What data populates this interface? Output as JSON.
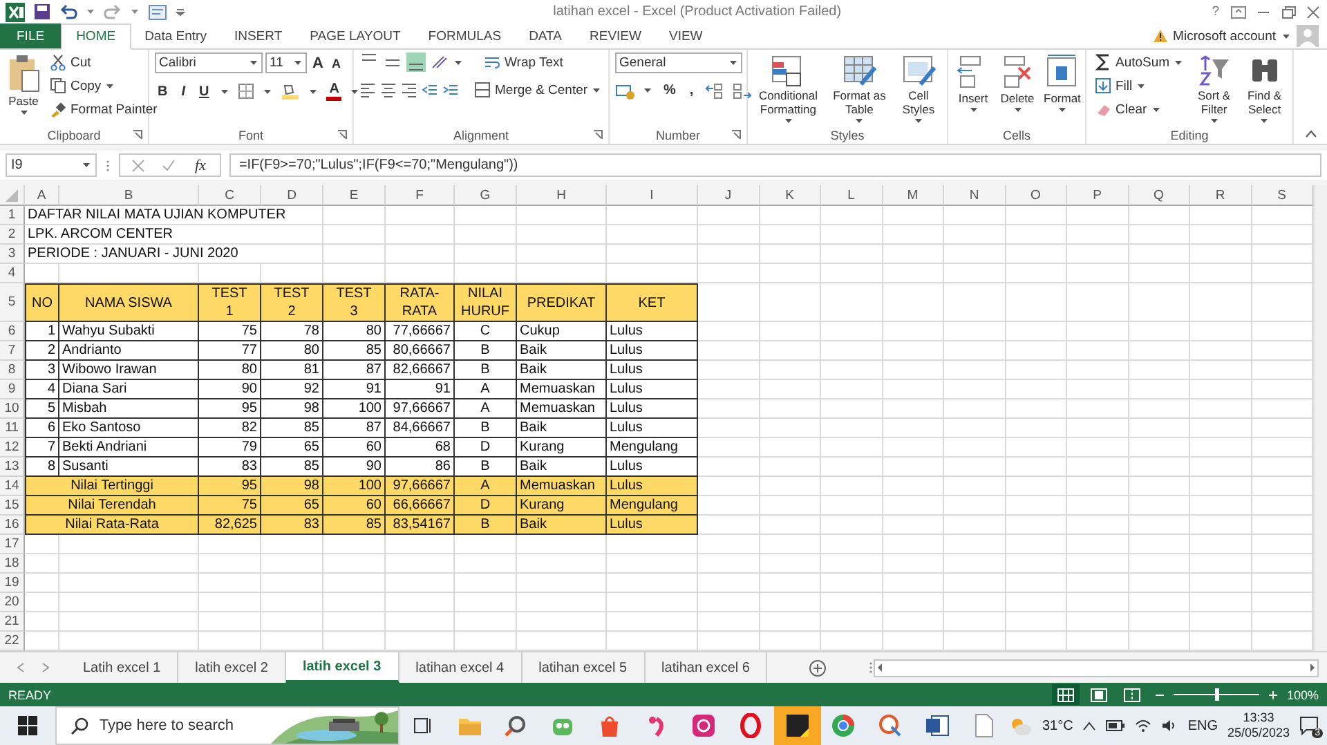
{
  "title_bar": {
    "title": "latihan excel - Excel (Product Activation Failed)",
    "help": "?"
  },
  "ribbon_tabs": [
    {
      "label": "FILE",
      "kind": "file",
      "selected": false
    },
    {
      "label": "HOME",
      "kind": "tab",
      "selected": true
    },
    {
      "label": "Data Entry",
      "kind": "tab",
      "selected": false
    },
    {
      "label": "INSERT",
      "kind": "tab",
      "selected": false
    },
    {
      "label": "PAGE LAYOUT",
      "kind": "tab",
      "selected": false
    },
    {
      "label": "FORMULAS",
      "kind": "tab",
      "selected": false
    },
    {
      "label": "DATA",
      "kind": "tab",
      "selected": false
    },
    {
      "label": "REVIEW",
      "kind": "tab",
      "selected": false
    },
    {
      "label": "VIEW",
      "kind": "tab",
      "selected": false
    }
  ],
  "account": {
    "label": "Microsoft account"
  },
  "ribbon_groups": [
    {
      "kind": "clipboard",
      "name": "Clipboard",
      "paste": "Paste",
      "cut": "Cut",
      "copy": "Copy",
      "format_painter": "Format Painter"
    },
    {
      "kind": "font",
      "name": "Font",
      "font": "Calibri",
      "size": "11",
      "grow": "A",
      "shrink": "A",
      "bold": "B",
      "italic": "I",
      "underline": "U",
      "font_color": "A"
    },
    {
      "kind": "alignment",
      "name": "Alignment",
      "vertical_align": [
        {
          "selected": false
        },
        {
          "selected": false
        },
        {
          "selected": true
        }
      ],
      "wrap": "Wrap Text",
      "merge": "Merge & Center"
    },
    {
      "kind": "number",
      "name": "Number",
      "format": "General",
      "percent": "%",
      "comma": ","
    },
    {
      "kind": "styles",
      "name": "Styles",
      "items": [
        "Conditional Formatting",
        "Format as Table",
        "Cell Styles"
      ]
    },
    {
      "kind": "cells",
      "name": "Cells",
      "items": [
        "Insert",
        "Delete",
        "Format"
      ]
    },
    {
      "kind": "editing",
      "name": "Editing",
      "autosum": "AutoSum",
      "fill": "Fill",
      "clear": "Clear",
      "sort": "Sort & Filter",
      "find": "Find & Select"
    }
  ],
  "formula_bar": {
    "name_box": "I9",
    "function_label": "fx",
    "formula": "=IF(F9>=70;\"Lulus\";IF(F9<=70;\"Mengulang\"))"
  },
  "sheet": {
    "columns": [
      "A",
      "B",
      "C",
      "D",
      "E",
      "F",
      "G",
      "H",
      "I",
      "J",
      "K",
      "L",
      "M",
      "N",
      "O",
      "P",
      "Q",
      "R",
      "S"
    ],
    "rows": [
      {
        "number": "1",
        "kind": "title",
        "text": "DAFTAR NILAI MATA UJIAN KOMPUTER"
      },
      {
        "number": "2",
        "kind": "title",
        "text": "LPK. ARCOM CENTER"
      },
      {
        "number": "3",
        "kind": "title",
        "text": "PERIODE : JANUARI - JUNI 2020"
      },
      {
        "number": "4",
        "kind": "empty"
      },
      {
        "number": "5",
        "kind": "header",
        "cells": [
          "NO",
          "NAMA SISWA",
          "TEST\n1",
          "TEST\n2",
          "TEST\n3",
          "RATA-\nRATA",
          "NILAI\nHURUF",
          "PREDIKAT",
          "KET"
        ]
      },
      {
        "number": "6",
        "kind": "data",
        "cells": [
          "1",
          "Wahyu Subakti",
          "75",
          "78",
          "80",
          "77,66667",
          "C",
          "Cukup",
          "Lulus"
        ]
      },
      {
        "number": "7",
        "kind": "data",
        "cells": [
          "2",
          "Andrianto",
          "77",
          "80",
          "85",
          "80,66667",
          "B",
          "Baik",
          "Lulus"
        ]
      },
      {
        "number": "8",
        "kind": "data",
        "cells": [
          "3",
          "Wibowo Irawan",
          "80",
          "81",
          "87",
          "82,66667",
          "B",
          "Baik",
          "Lulus"
        ]
      },
      {
        "number": "9",
        "kind": "data",
        "cells": [
          "4",
          "Diana Sari",
          "90",
          "92",
          "91",
          "91",
          "A",
          "Memuaskan",
          "Lulus"
        ]
      },
      {
        "number": "10",
        "kind": "data",
        "cells": [
          "5",
          "Misbah",
          "95",
          "98",
          "100",
          "97,66667",
          "A",
          "Memuaskan",
          "Lulus"
        ]
      },
      {
        "number": "11",
        "kind": "data",
        "cells": [
          "6",
          "Eko Santoso",
          "82",
          "85",
          "87",
          "84,66667",
          "B",
          "Baik",
          "Lulus"
        ]
      },
      {
        "number": "12",
        "kind": "data",
        "cells": [
          "7",
          "Bekti Andriani",
          "79",
          "65",
          "60",
          "68",
          "D",
          "Kurang",
          "Mengulang"
        ]
      },
      {
        "number": "13",
        "kind": "data",
        "cells": [
          "8",
          "Susanti",
          "83",
          "85",
          "90",
          "86",
          "B",
          "Baik",
          "Lulus"
        ]
      },
      {
        "number": "14",
        "kind": "summary",
        "label": "Nilai Tertinggi",
        "cells": [
          "95",
          "98",
          "100",
          "97,66667",
          "A",
          "Memuaskan",
          "Lulus"
        ]
      },
      {
        "number": "15",
        "kind": "summary",
        "label": "Nilai Terendah",
        "cells": [
          "75",
          "65",
          "60",
          "66,66667",
          "D",
          "Kurang",
          "Mengulang"
        ]
      },
      {
        "number": "16",
        "kind": "summary",
        "label": "Nilai Rata-Rata",
        "cells": [
          "82,625",
          "83",
          "85",
          "83,54167",
          "B",
          "Baik",
          "Lulus"
        ]
      },
      {
        "number": "17",
        "kind": "empty"
      },
      {
        "number": "18",
        "kind": "empty"
      },
      {
        "number": "19",
        "kind": "empty"
      },
      {
        "number": "20",
        "kind": "empty"
      },
      {
        "number": "21",
        "kind": "empty"
      },
      {
        "number": "22",
        "kind": "empty"
      }
    ]
  },
  "sheet_tabs": [
    {
      "label": "Latih excel 1",
      "selected": false
    },
    {
      "label": "latih excel 2",
      "selected": false
    },
    {
      "label": "latih excel 3",
      "selected": true
    },
    {
      "label": "latihan excel 4",
      "selected": false
    },
    {
      "label": "latihan excel 5",
      "selected": false
    },
    {
      "label": "latihan excel 6",
      "selected": false
    }
  ],
  "status_bar": {
    "status": "READY",
    "views": [
      {
        "kind": "normal",
        "selected": true
      },
      {
        "kind": "layout",
        "selected": false
      },
      {
        "kind": "break",
        "selected": false
      }
    ],
    "zoom": {
      "level": 0.5,
      "reading": "100%"
    }
  },
  "taskbar": {
    "search": {
      "placeholder": "Type here to search"
    },
    "apps": [
      {
        "kind": "taskview",
        "selected": false
      },
      {
        "kind": "folder",
        "selected": false
      },
      {
        "kind": "magnifier",
        "selected": false
      },
      {
        "kind": "robot",
        "selected": false
      },
      {
        "kind": "bag",
        "selected": false
      },
      {
        "kind": "bstation",
        "selected": false
      },
      {
        "kind": "camera",
        "selected": false
      },
      {
        "kind": "ring",
        "selected": false
      },
      {
        "kind": "notes",
        "selected": true
      },
      {
        "kind": "browser",
        "selected": false
      },
      {
        "kind": "paint",
        "selected": false
      },
      {
        "kind": "word",
        "selected": false
      },
      {
        "kind": "file",
        "selected": false
      }
    ],
    "weather": "31°C",
    "language": "ENG",
    "time": "13:33",
    "date": "25/05/2023",
    "notifications": "3"
  }
}
